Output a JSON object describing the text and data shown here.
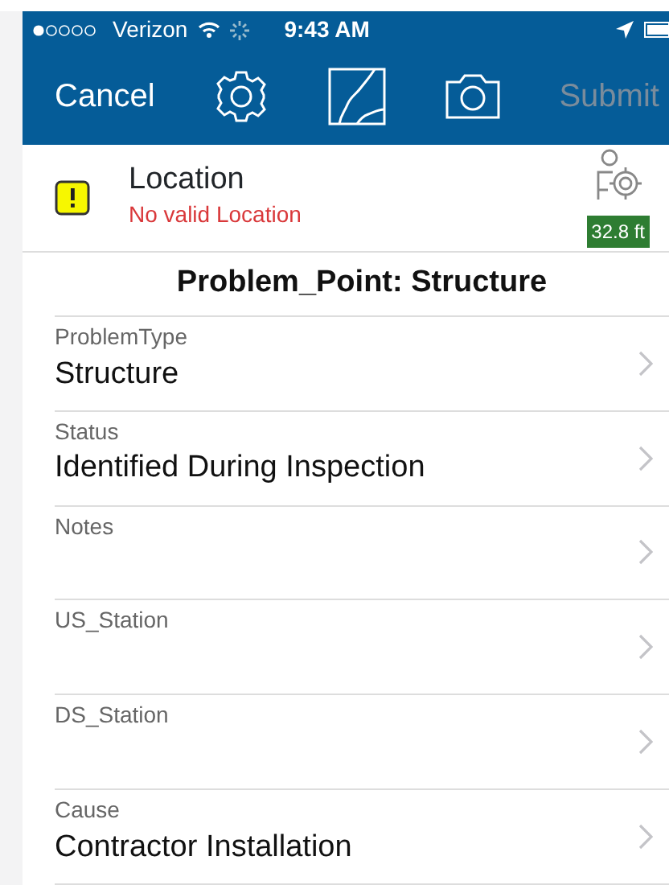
{
  "status_bar": {
    "carrier": "Verizon",
    "time": "9:43 AM"
  },
  "toolbar": {
    "cancel": "Cancel",
    "submit": {
      "label": "Submit",
      "disabled": true
    }
  },
  "location": {
    "title": "Location",
    "message": "No valid Location",
    "accuracy": "32.8 ft"
  },
  "form_title": "Problem_Point: Structure",
  "fields": [
    {
      "label": "ProblemType",
      "value": "Structure"
    },
    {
      "label": "Status",
      "value": "Identified During Inspection"
    },
    {
      "label": "Notes"
    },
    {
      "label": "US_Station"
    },
    {
      "label": "DS_Station"
    },
    {
      "label": "Cause",
      "value": "Contractor Installation"
    }
  ]
}
